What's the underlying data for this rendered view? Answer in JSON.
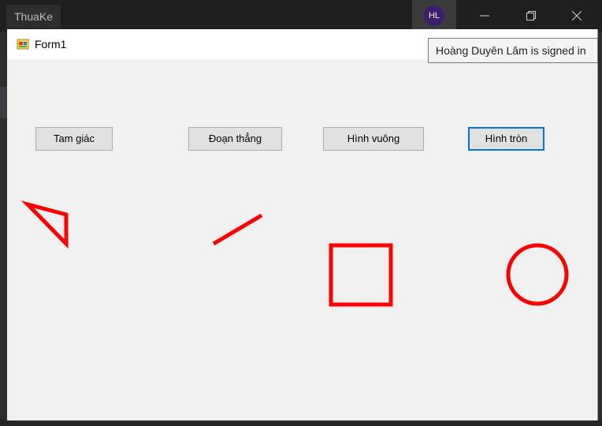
{
  "ide": {
    "tab_label": "ThuaKe",
    "avatar_initials": "HL"
  },
  "window": {
    "title": "Form1"
  },
  "tooltip": {
    "text": "Hoàng Duyên Lâm is signed in"
  },
  "buttons": [
    {
      "label": "Tam giác"
    },
    {
      "label": "Đoạn thẳng"
    },
    {
      "label": "Hình vuông"
    },
    {
      "label": "Hình tròn"
    }
  ],
  "colors": {
    "shape_stroke": "#ff0000",
    "focus_border": "#0078d7"
  },
  "icons": [
    "minimize-icon",
    "restore-icon",
    "close-icon",
    "form-app-icon"
  ]
}
